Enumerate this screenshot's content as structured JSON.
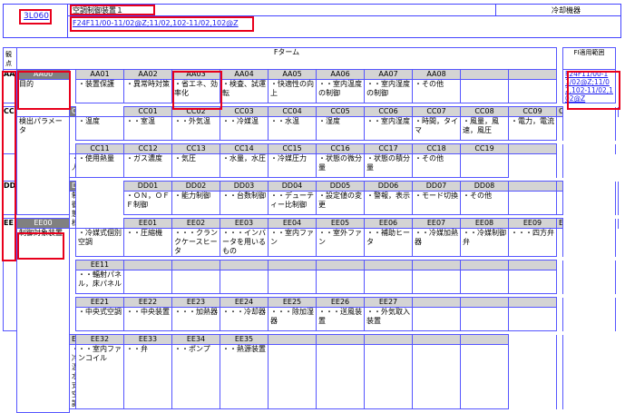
{
  "top": {
    "code": "3L060",
    "title": "空調制御装置１",
    "category": "冷却機器",
    "fi_link": "F24F11/00-11/02@Z;11/02,102-11/02,102@Z"
  },
  "table": {
    "col_label": "観点",
    "fterm_header": "Fターム",
    "fi_header": "FI適用範囲",
    "fi_value": "F24F11/00-11/02@Z;11/02,102-11/02,102@Z",
    "groups": [
      {
        "key": "AA",
        "head": "AA00",
        "desc": "目的",
        "blocks": [
          [
            [
              "AA01",
              "・装置保護"
            ],
            [
              "AA02",
              "・異常時対策"
            ],
            [
              "AA03",
              "・省エネ、効率化"
            ],
            [
              "AA04",
              "・検査、試運転"
            ],
            [
              "AA05",
              "・快適性の向上"
            ],
            [
              "AA06",
              "・・室内温度の制御"
            ],
            [
              "AA07",
              "・・室内湿度の制御"
            ],
            [
              "AA08",
              "・その他"
            ],
            [
              "",
              ""
            ],
            [
              "",
              ""
            ]
          ]
        ]
      },
      {
        "key": "CC",
        "head": "CC00",
        "desc": "検出パラメータ",
        "blocks": [
          [
            [
              "CC01",
              "・温度"
            ],
            [
              "CC02",
              "・・室温"
            ],
            [
              "CC03",
              "・・外気温"
            ],
            [
              "CC04",
              "・・冷媒温"
            ],
            [
              "CC05",
              "・・水温"
            ],
            [
              "CC06",
              "・湿度"
            ],
            [
              "CC07",
              "・・室内湿度"
            ],
            [
              "CC08",
              "・時間，タイマ"
            ],
            [
              "CC09",
              "・風量，風速，風圧"
            ],
            [
              "CC10",
              "・電力，電流"
            ]
          ],
          [
            [
              "CC11",
              "・人"
            ],
            [
              "CC12",
              "・使用熱量"
            ],
            [
              "CC13",
              "・ガス濃度"
            ],
            [
              "CC14",
              "・気圧"
            ],
            [
              "CC15",
              "・水量，水圧"
            ],
            [
              "CC16",
              "・冷媒圧力"
            ],
            [
              "CC17",
              "・状態の微分量"
            ],
            [
              "CC18",
              "・状態の積分量"
            ],
            [
              "CC19",
              "・その他"
            ],
            [
              "",
              ""
            ]
          ]
        ]
      },
      {
        "key": "DD",
        "head": "DD00",
        "desc": "制御態様",
        "blocks": [
          [
            [
              "DD01",
              "・ＯＮ，ＯＦＦ制御"
            ],
            [
              "DD02",
              "・能力制御"
            ],
            [
              "DD03",
              "・・台数制御"
            ],
            [
              "DD04",
              "・・デューティー比制御"
            ],
            [
              "DD05",
              "・設定値の変更"
            ],
            [
              "DD06",
              "・警報，表示"
            ],
            [
              "DD07",
              "・モード切換"
            ],
            [
              "DD08",
              "・その他"
            ],
            [
              "",
              ""
            ],
            [
              "",
              ""
            ]
          ]
        ]
      },
      {
        "key": "EE",
        "head": "EE00",
        "desc": "制御対象装置",
        "blocks": [
          [
            [
              "EE01",
              "・冷媒式個別空調"
            ],
            [
              "EE02",
              "・・圧縮機"
            ],
            [
              "EE03",
              "・・・クランクケースヒータ"
            ],
            [
              "EE04",
              "・・・インバータを用いるもの"
            ],
            [
              "EE05",
              "・・室内ファン"
            ],
            [
              "EE06",
              "・・室外ファン"
            ],
            [
              "EE07",
              "・・補助ヒータ"
            ],
            [
              "EE08",
              "・・冷媒加熱器"
            ],
            [
              "EE09",
              "・・冷媒制御弁"
            ],
            [
              "EE10",
              "・・・四方弁"
            ]
          ],
          [
            [
              "EE11",
              "・・輻射パネル，床パネル"
            ],
            [
              "",
              ""
            ],
            [
              "",
              ""
            ],
            [
              "",
              ""
            ],
            [
              "",
              ""
            ],
            [
              "",
              ""
            ],
            [
              "",
              ""
            ],
            [
              "",
              ""
            ],
            [
              "",
              ""
            ],
            [
              "",
              ""
            ]
          ],
          [
            [
              "EE21",
              "・中央式空調"
            ],
            [
              "EE22",
              "・・中央装置"
            ],
            [
              "EE23",
              "・・・加熱器"
            ],
            [
              "EE24",
              "・・・冷却器"
            ],
            [
              "EE25",
              "・・・除加湿器"
            ],
            [
              "EE26",
              "・・・送風装置"
            ],
            [
              "EE27",
              "・・外気取入装置"
            ],
            [
              "",
              ""
            ],
            [
              "",
              ""
            ],
            [
              "",
              ""
            ]
          ],
          [
            [
              "EE31",
              "・冷温水式空調"
            ],
            [
              "EE32",
              "・・室内ファンコイル"
            ],
            [
              "EE33",
              "・・弁"
            ],
            [
              "EE34",
              "・・ポンプ"
            ],
            [
              "EE35",
              "・・熱源装置"
            ],
            [
              "",
              ""
            ],
            [
              "",
              ""
            ],
            [
              "",
              ""
            ],
            [
              "",
              ""
            ],
            [
              "",
              ""
            ]
          ]
        ]
      }
    ]
  }
}
